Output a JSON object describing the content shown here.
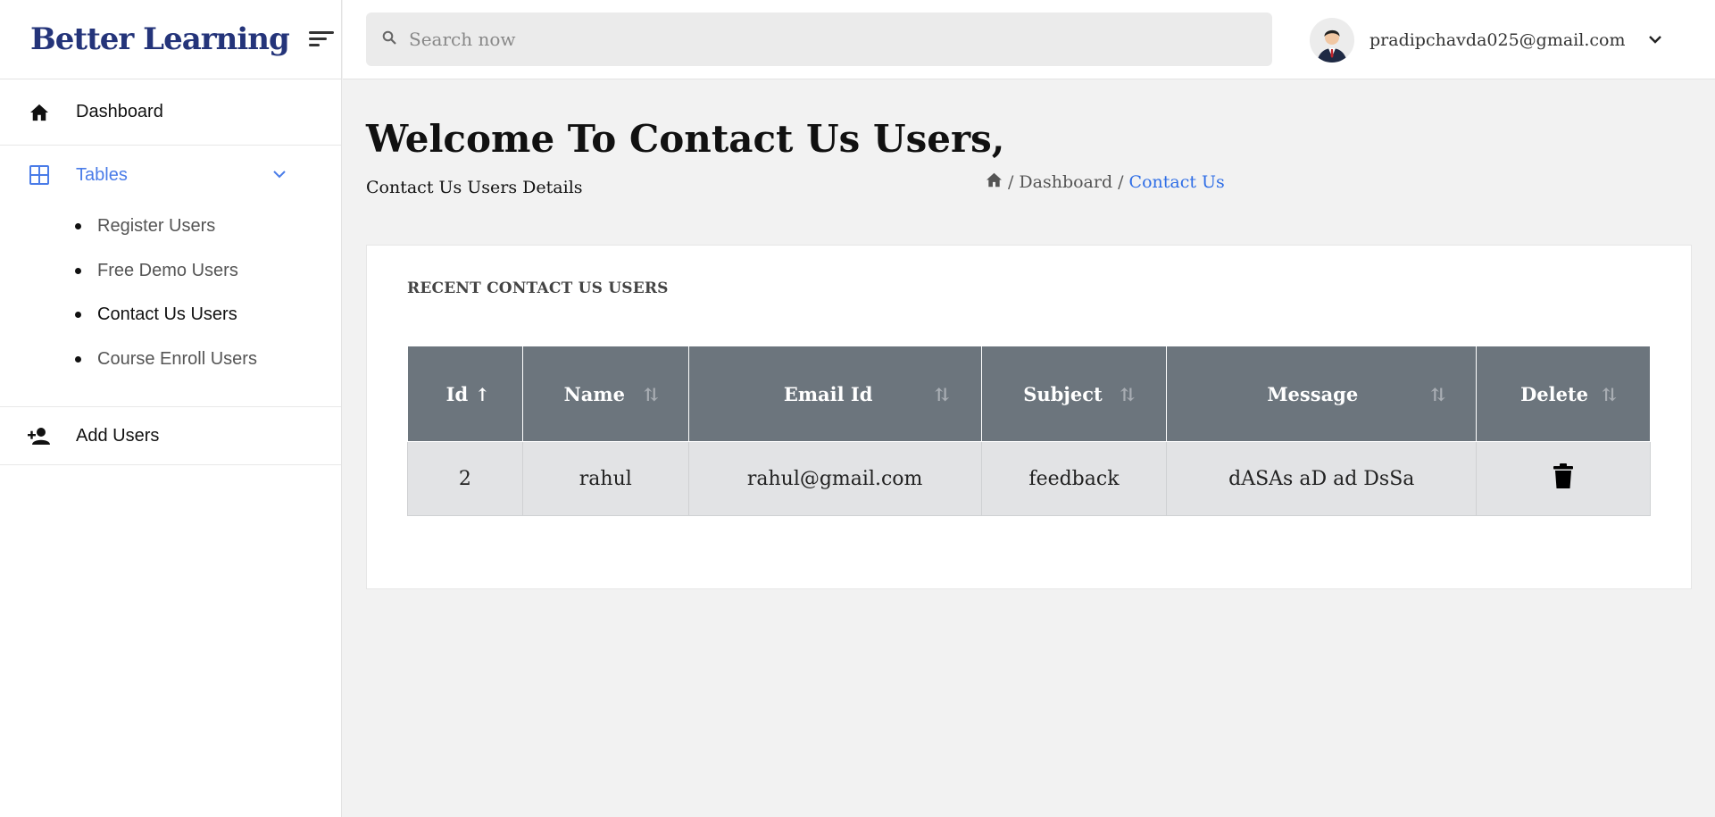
{
  "brand": "Better Learning",
  "search": {
    "placeholder": "Search now"
  },
  "user": {
    "email": "pradipchavda025@gmail.com"
  },
  "sidebar": {
    "dashboard": "Dashboard",
    "tables": "Tables",
    "submenu": [
      "Register Users",
      "Free Demo Users",
      "Contact Us Users",
      "Course Enroll Users"
    ],
    "add_users": "Add Users"
  },
  "page": {
    "title": "Welcome To Contact Us Users,",
    "subtitle": "Contact Us Users Details"
  },
  "breadcrumb": {
    "sep": "/",
    "dashboard": "Dashboard",
    "current": "Contact Us"
  },
  "card": {
    "title": "RECENT CONTACT US USERS"
  },
  "table": {
    "headers": [
      "Id",
      "Name",
      "Email Id",
      "Subject",
      "Message",
      "Delete"
    ],
    "rows": [
      {
        "id": "2",
        "name": "rahul",
        "email": "rahul@gmail.com",
        "subject": "feedback",
        "message": "dASAs aD ad DsSa"
      }
    ]
  },
  "colors": {
    "brand": "#24347a",
    "accent": "#4a7ce8",
    "header_bg": "#6c757d",
    "row_bg": "#e2e3e5"
  }
}
